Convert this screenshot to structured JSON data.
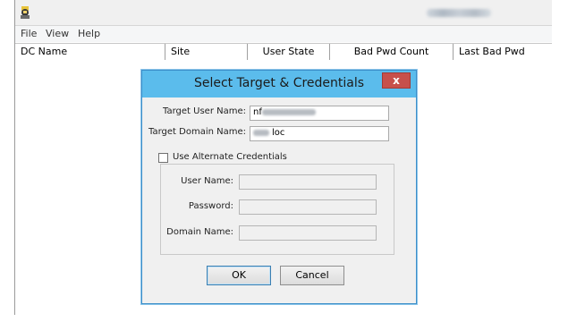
{
  "menu": {
    "items": [
      "File",
      "View",
      "Help"
    ]
  },
  "list": {
    "columns": [
      "DC Name",
      "Site",
      "User State",
      "Bad Pwd Count",
      "Last Bad Pwd"
    ]
  },
  "dialog": {
    "title": "Select Target & Credentials",
    "close_label": "x",
    "target_user_label": "Target User Name:",
    "target_user_value": "nf",
    "target_domain_label": "Target Domain Name:",
    "target_domain_value": "loc",
    "use_alternate_label": "Use Alternate Credentials",
    "use_alternate_checked": false,
    "user_name_label": "User Name:",
    "password_label": "Password:",
    "domain_name_label": "Domain Name:",
    "ok_label": "OK",
    "cancel_label": "Cancel"
  },
  "icons": {
    "app": "app-icon",
    "close": "close-icon"
  },
  "colors": {
    "dialog_title_bg": "#5bbcec",
    "close_bg": "#c7504b"
  }
}
